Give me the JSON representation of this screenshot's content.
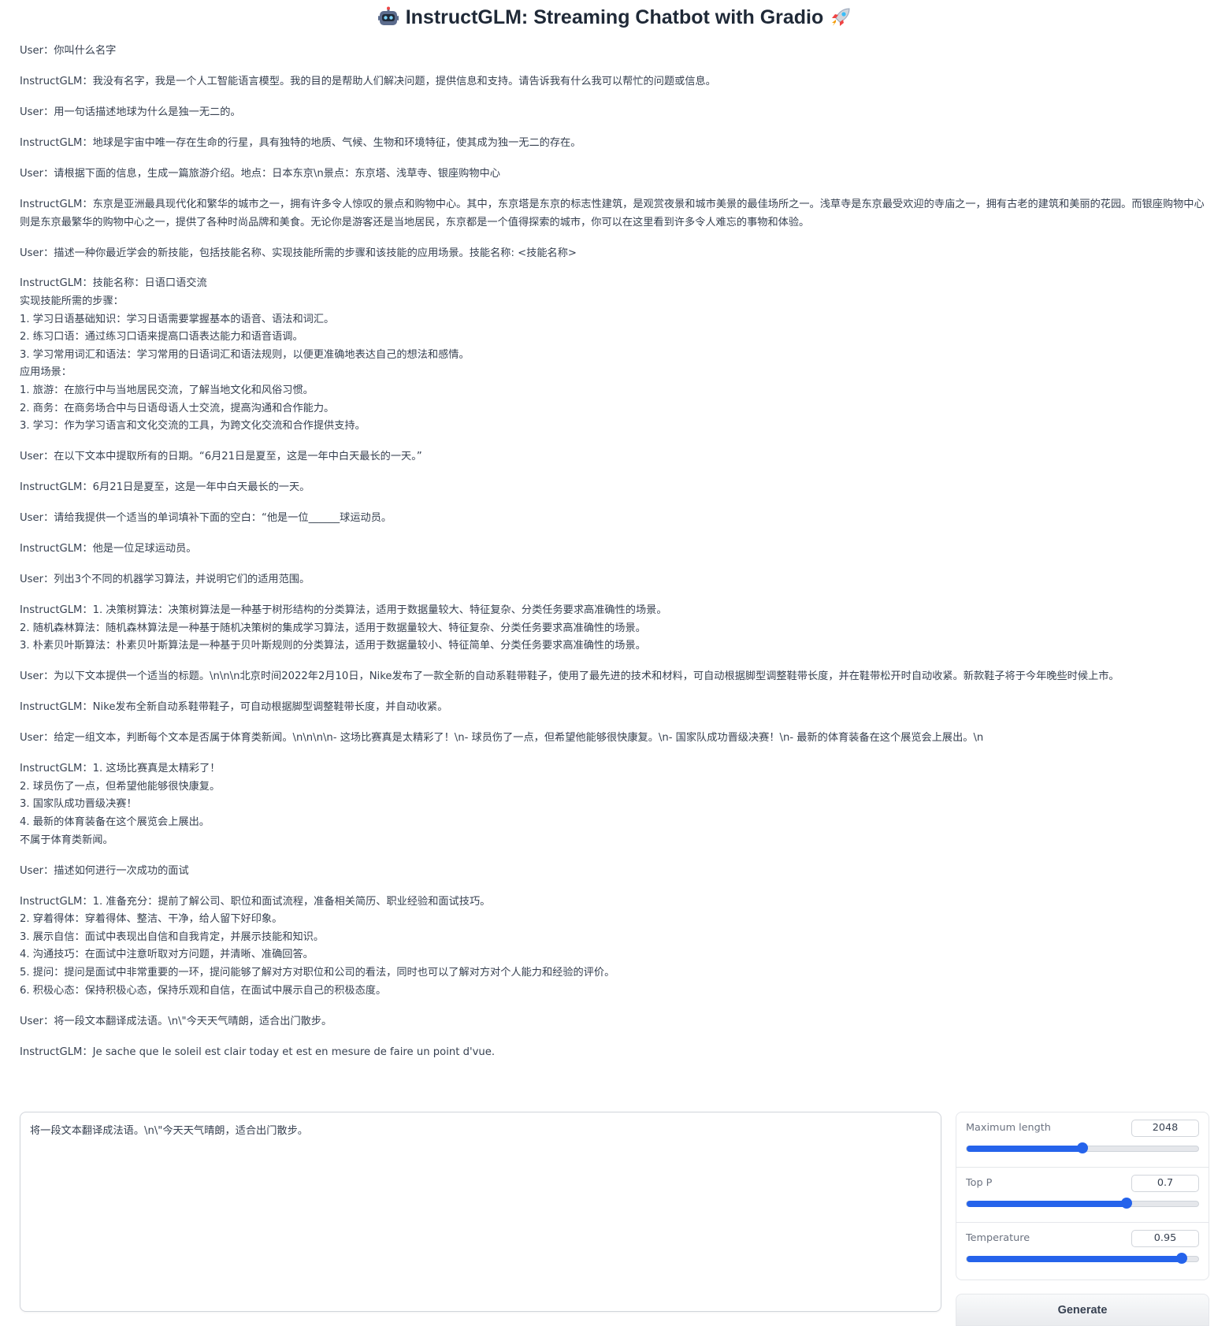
{
  "header": {
    "title": "InstructGLM: Streaming Chatbot with Gradio",
    "left_icon": "robot-icon",
    "right_icon": "rocket-icon"
  },
  "chat": [
    {
      "role": "User",
      "text": "User：你叫什么名字"
    },
    {
      "role": "InstructGLM",
      "text": "InstructGLM：我没有名字，我是一个人工智能语言模型。我的目的是帮助人们解决问题，提供信息和支持。请告诉我有什么我可以帮忙的问题或信息。"
    },
    {
      "role": "User",
      "text": "User：用一句话描述地球为什么是独一无二的。"
    },
    {
      "role": "InstructGLM",
      "text": "InstructGLM：地球是宇宙中唯一存在生命的行星，具有独特的地质、气候、生物和环境特征，使其成为独一无二的存在。"
    },
    {
      "role": "User",
      "text": "User：请根据下面的信息，生成一篇旅游介绍。地点：日本东京\\n景点：东京塔、浅草寺、银座购物中心"
    },
    {
      "role": "InstructGLM",
      "text": "InstructGLM：东京是亚洲最具现代化和繁华的城市之一，拥有许多令人惊叹的景点和购物中心。其中，东京塔是东京的标志性建筑，是观赏夜景和城市美景的最佳场所之一。浅草寺是东京最受欢迎的寺庙之一，拥有古老的建筑和美丽的花园。而银座购物中心则是东京最繁华的购物中心之一，提供了各种时尚品牌和美食。无论你是游客还是当地居民，东京都是一个值得探索的城市，你可以在这里看到许多令人难忘的事物和体验。"
    },
    {
      "role": "User",
      "text": "User：描述一种你最近学会的新技能，包括技能名称、实现技能所需的步骤和该技能的应用场景。技能名称: <技能名称>"
    },
    {
      "role": "InstructGLM",
      "text": "InstructGLM：技能名称：日语口语交流\n实现技能所需的步骤：\n1. 学习日语基础知识：学习日语需要掌握基本的语音、语法和词汇。\n2. 练习口语：通过练习口语来提高口语表达能力和语音语调。\n3. 学习常用词汇和语法：学习常用的日语词汇和语法规则，以便更准确地表达自己的想法和感情。\n应用场景：\n1. 旅游：在旅行中与当地居民交流，了解当地文化和风俗习惯。\n2. 商务：在商务场合中与日语母语人士交流，提高沟通和合作能力。\n3. 学习：作为学习语言和文化交流的工具，为跨文化交流和合作提供支持。"
    },
    {
      "role": "User",
      "text": "User：在以下文本中提取所有的日期。“6月21日是夏至，这是一年中白天最长的一天。”"
    },
    {
      "role": "InstructGLM",
      "text": "InstructGLM：6月21日是夏至，这是一年中白天最长的一天。"
    },
    {
      "role": "User",
      "text": "User：请给我提供一个适当的单词填补下面的空白：“他是一位______球运动员。"
    },
    {
      "role": "InstructGLM",
      "text": "InstructGLM：他是一位足球运动员。"
    },
    {
      "role": "User",
      "text": "User：列出3个不同的机器学习算法，并说明它们的适用范围。"
    },
    {
      "role": "InstructGLM",
      "text": "InstructGLM：1. 决策树算法：决策树算法是一种基于树形结构的分类算法，适用于数据量较大、特征复杂、分类任务要求高准确性的场景。\n2. 随机森林算法：随机森林算法是一种基于随机决策树的集成学习算法，适用于数据量较大、特征复杂、分类任务要求高准确性的场景。\n3. 朴素贝叶斯算法：朴素贝叶斯算法是一种基于贝叶斯规则的分类算法，适用于数据量较小、特征简单、分类任务要求高准确性的场景。"
    },
    {
      "role": "User",
      "text": "User：为以下文本提供一个适当的标题。\\n\\n\\n北京时间2022年2月10日，Nike发布了一款全新的自动系鞋带鞋子，使用了最先进的技术和材料，可自动根据脚型调整鞋带长度，并在鞋带松开时自动收紧。新款鞋子将于今年晚些时候上市。"
    },
    {
      "role": "InstructGLM",
      "text": "InstructGLM：Nike发布全新自动系鞋带鞋子，可自动根据脚型调整鞋带长度，并自动收紧。"
    },
    {
      "role": "User",
      "text": "User：给定一组文本，判断每个文本是否属于体育类新闻。\\n\\n\\n\\n- 这场比赛真是太精彩了！\\n- 球员伤了一点，但希望他能够很快康复。\\n- 国家队成功晋级决赛！\\n- 最新的体育装备在这个展览会上展出。\\n"
    },
    {
      "role": "InstructGLM",
      "text": "InstructGLM：1. 这场比赛真是太精彩了！\n2. 球员伤了一点，但希望他能够很快康复。\n3. 国家队成功晋级决赛！\n4. 最新的体育装备在这个展览会上展出。\n不属于体育类新闻。"
    },
    {
      "role": "User",
      "text": "User：描述如何进行一次成功的面试"
    },
    {
      "role": "InstructGLM",
      "text": "InstructGLM：1. 准备充分：提前了解公司、职位和面试流程，准备相关简历、职业经验和面试技巧。\n2. 穿着得体：穿着得体、整洁、干净，给人留下好印象。\n3. 展示自信：面试中表现出自信和自我肯定，并展示技能和知识。\n4. 沟通技巧：在面试中注意听取对方问题，并清晰、准确回答。\n5. 提问：提问是面试中非常重要的一环，提问能够了解对方对职位和公司的看法，同时也可以了解对方对个人能力和经验的评价。\n6. 积极心态：保持积极心态，保持乐观和自信，在面试中展示自己的积极态度。"
    },
    {
      "role": "User",
      "text": "User：将一段文本翻译成法语。\\n\\\"今天天气晴朗，适合出门散步。"
    },
    {
      "role": "InstructGLM",
      "text": "InstructGLM：Je sache que le soleil est clair today et est en mesure de faire un point d'vue."
    }
  ],
  "input": {
    "value": "将一段文本翻译成法语。\\n\\\"今天天气晴朗，适合出门散步。"
  },
  "controls": {
    "max_length": {
      "label": "Maximum length",
      "value": "2048",
      "fraction": 0.5
    },
    "top_p": {
      "label": "Top P",
      "value": "0.7",
      "fraction": 0.69
    },
    "temperature": {
      "label": "Temperature",
      "value": "0.95",
      "fraction": 0.93
    }
  },
  "generate_label": "Generate",
  "colors": {
    "accent": "#2563eb",
    "text": "#374151"
  }
}
